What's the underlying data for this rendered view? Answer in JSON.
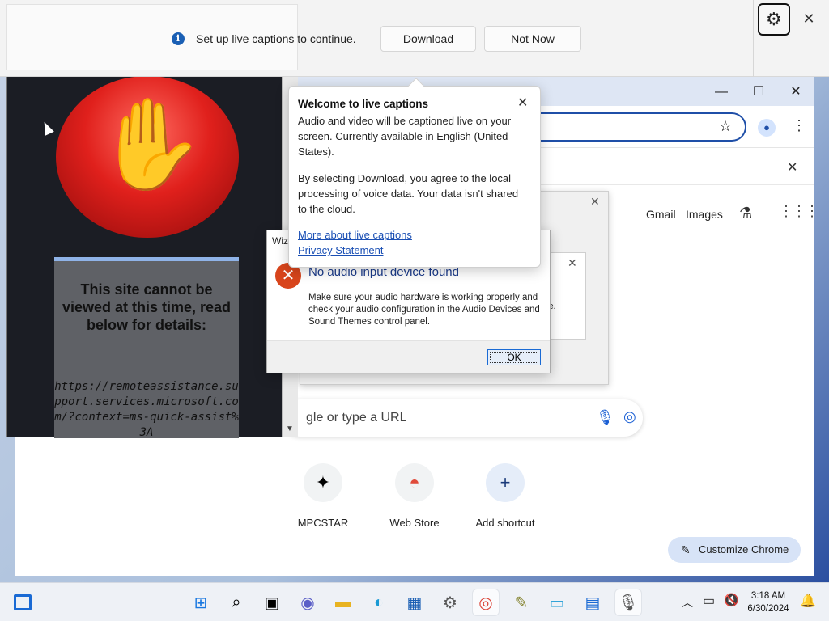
{
  "live_captions_bar": {
    "message": "Set up live captions to continue.",
    "download_label": "Download",
    "not_now_label": "Not Now"
  },
  "chrome": {
    "ntp_links": [
      "Gmail",
      "Images"
    ],
    "search_placeholder": "gle or type a URL",
    "shortcuts": [
      {
        "label": "MPCSTAR"
      },
      {
        "label": "Web Store"
      },
      {
        "label": "Add shortcut"
      }
    ],
    "customize_label": "Customize Chrome"
  },
  "blocked_page": {
    "title": "This site cannot be viewed at this time, read below for details:",
    "url": "https://remoteassistance.support.services.microsoft.com/?context=ms-quick-assist%3A"
  },
  "error_dialog": {
    "title_fragment": "Wiz",
    "heading": "No audio input device found",
    "body": "Make sure your audio hardware is working properly and check your audio configuration in the Audio Devices and Sound Themes control panel.",
    "ok_label": "OK",
    "bg_fragment": "le."
  },
  "live_captions_popup": {
    "title": "Welcome to live captions",
    "para1": "Audio and video will be captioned live on your screen. Currently available in English (United States).",
    "para2": "By selecting Download, you agree to the local processing of voice data. Your data isn't shared to the cloud.",
    "link1": "More about live captions",
    "link2": "Privacy Statement"
  },
  "taskbar": {
    "time": "3:18 AM",
    "date": "6/30/2024"
  },
  "colors": {
    "accent": "#1f4fa8",
    "stop_red": "#e0201c",
    "error_orange": "#d8451c"
  }
}
